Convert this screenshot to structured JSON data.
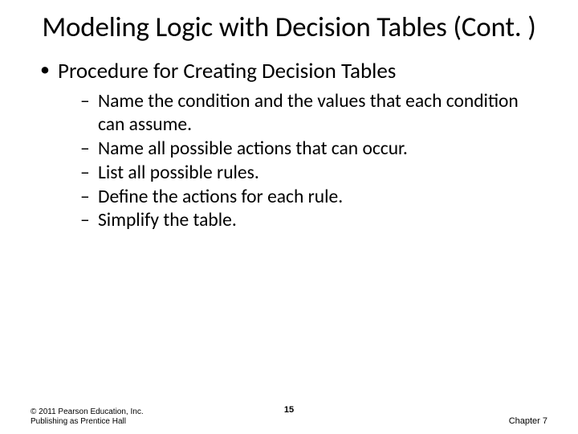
{
  "title": "Modeling Logic with Decision Tables (Cont. )",
  "level1_item": "Procedure for Creating Decision Tables",
  "level2_items": [
    "Name the condition and the values that each condition can assume.",
    "Name all possible actions that can occur.",
    "List all possible rules.",
    "Define the actions for each rule.",
    "Simplify the table."
  ],
  "footer": {
    "copyright": "© 2011 Pearson Education, Inc. Publishing as Prentice Hall",
    "page_number": "15",
    "chapter": "Chapter 7"
  }
}
